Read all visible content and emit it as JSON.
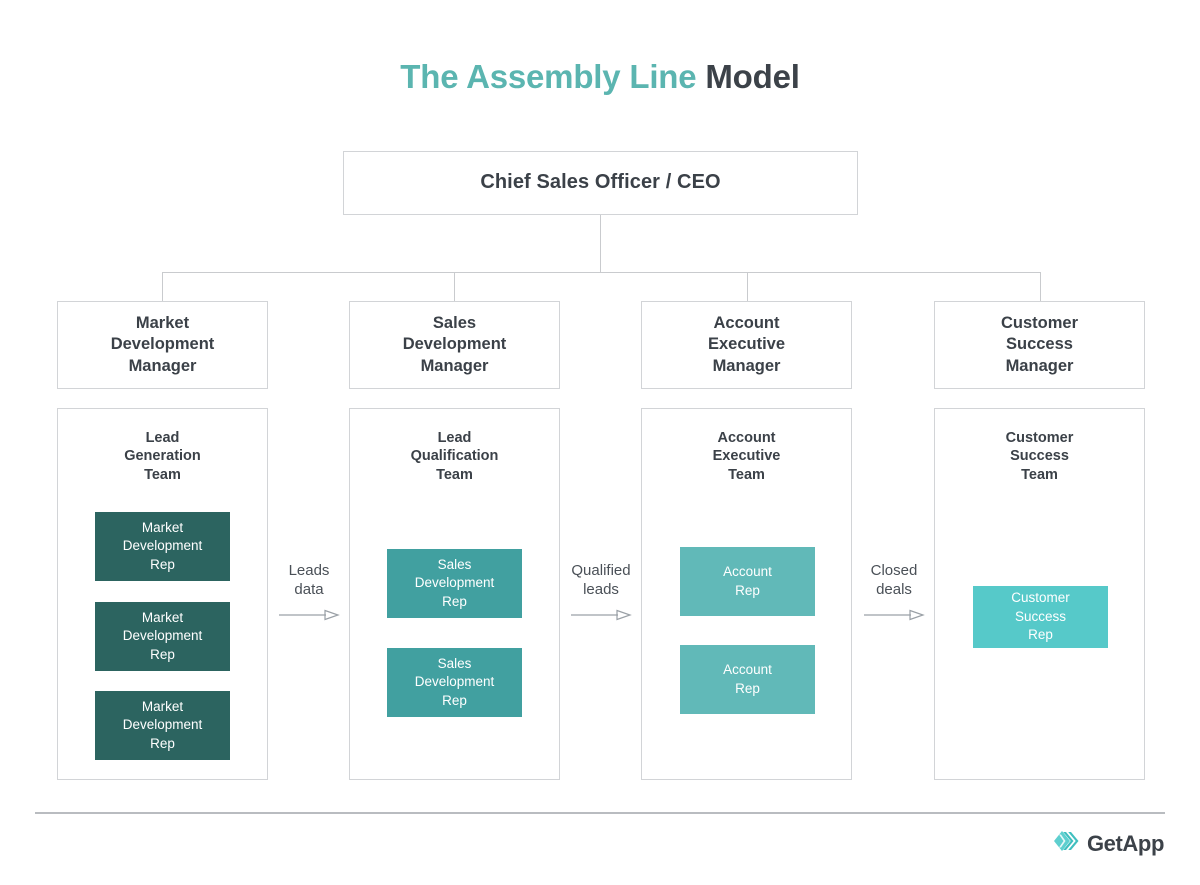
{
  "title": {
    "accent_text": "The Assembly Line",
    "plain_text": "Model"
  },
  "colors": {
    "accent": "#5bb5b0",
    "dark_text": "#3c4249",
    "border": "#d2d4d7",
    "rep_dark_teal": "#2c6460",
    "rep_mid_teal": "#41a0a0",
    "rep_light_teal": "#61b9b8",
    "rep_lightest_teal": "#56c9c9"
  },
  "org": {
    "executive": {
      "label": "Chief Sales Officer / CEO"
    },
    "columns": [
      {
        "manager": "Market\nDevelopment\nManager",
        "team_title": "Lead\nGeneration\nTeam",
        "reps": [
          {
            "label": "Market\nDevelopment\nRep"
          },
          {
            "label": "Market\nDevelopment\nRep"
          },
          {
            "label": "Market\nDevelopment\nRep"
          }
        ]
      },
      {
        "manager": "Sales\nDevelopment\nManager",
        "team_title": "Lead\nQualification\nTeam",
        "reps": [
          {
            "label": "Sales\nDevelopment\nRep"
          },
          {
            "label": "Sales\nDevelopment\nRep"
          }
        ]
      },
      {
        "manager": "Account\nExecutive\nManager",
        "team_title": "Account\nExecutive\nTeam",
        "reps": [
          {
            "label": "Account\nRep"
          },
          {
            "label": "Account\nRep"
          }
        ]
      },
      {
        "manager": "Customer\nSuccess\nManager",
        "team_title": "Customer\nSuccess\nTeam",
        "reps": [
          {
            "label": "Customer\nSuccess\nRep"
          }
        ]
      }
    ],
    "flows": [
      {
        "label": "Leads\ndata"
      },
      {
        "label": "Qualified\nleads"
      },
      {
        "label": "Closed\ndeals"
      }
    ]
  },
  "footer": {
    "brand": "GetApp",
    "logo_icon": "getapp-chevron-icon"
  }
}
